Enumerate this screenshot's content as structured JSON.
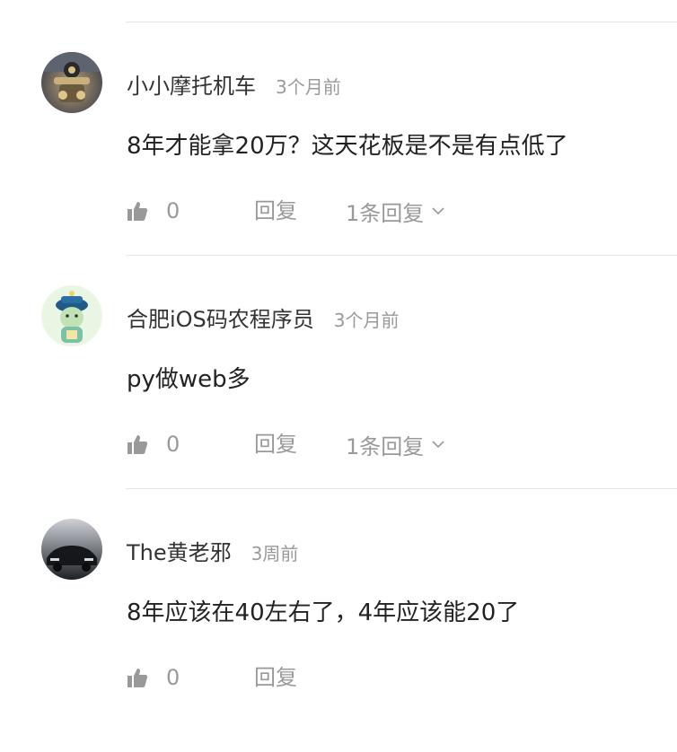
{
  "colors": {
    "text_primary": "#222222",
    "text_secondary": "#999999",
    "divider": "#e6e6e6"
  },
  "comments": [
    {
      "username": "小小摩托机车",
      "time": "3个月前",
      "content": "8年才能拿20万？这天花板是不是有点低了",
      "likes": "0",
      "reply_label": "回复",
      "replies_label": "1条回复",
      "avatar_icon": "motorcycle-avatar"
    },
    {
      "username": "合肥iOS码农程序员",
      "time": "3个月前",
      "content": "py做web多",
      "likes": "0",
      "reply_label": "回复",
      "replies_label": "1条回复",
      "avatar_icon": "cartoon-official-avatar"
    },
    {
      "username": "The黄老邪",
      "time": "3周前",
      "content": "8年应该在40左右了，4年应该能20了",
      "likes": "0",
      "reply_label": "回复",
      "avatar_icon": "car-avatar"
    }
  ]
}
